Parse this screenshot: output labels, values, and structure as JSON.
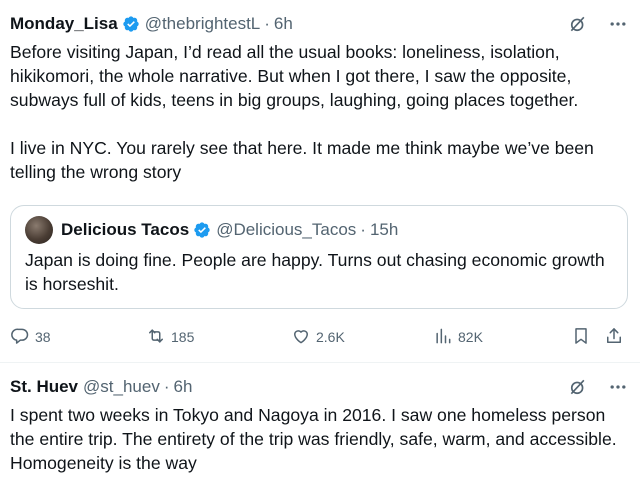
{
  "post1": {
    "display_name": "Monday_Lisa",
    "handle": "@thebrightestL",
    "time": "6h",
    "body": "Before visiting Japan, I’d read all the usual books: loneliness, isolation, hikikomori, the whole narrative. But when I got there, I saw the opposite, subways full of kids, teens in big groups, laughing, going places together.\n\nI live in NYC. You rarely see that here. It made me think maybe we’ve been telling the wrong story",
    "quote": {
      "display_name": "Delicious Tacos",
      "handle": "@Delicious_Tacos",
      "time": "15h",
      "body": "Japan is doing fine. People are happy. Turns out chasing economic growth is horseshit."
    },
    "stats": {
      "replies": "38",
      "reposts": "185",
      "likes": "2.6K",
      "views": "82K"
    }
  },
  "post2": {
    "display_name": "St. Huev",
    "handle": "@st_huev",
    "time": "6h",
    "body": "I spent two weeks in Tokyo and Nagoya in 2016. I saw one homeless person the entire trip. The entirety of the trip was friendly, safe, warm, and accessible. Homogeneity is the way"
  },
  "separator": "·",
  "colors": {
    "text": "#0f1419",
    "secondary": "#536471",
    "verified": "#1d9bf0",
    "border": "#cfd9de"
  },
  "icons": [
    "verified-badge-icon",
    "grok-slash-icon",
    "more-icon",
    "reply-icon",
    "repost-icon",
    "like-icon",
    "views-icon",
    "bookmark-icon",
    "share-icon"
  ]
}
